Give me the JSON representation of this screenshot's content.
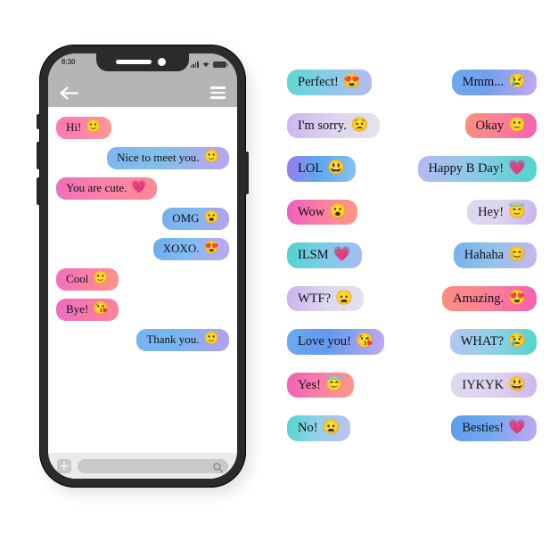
{
  "phone": {
    "status_bar": {
      "time": "8:30",
      "signal_icon": "signal-bars-icon",
      "wifi_icon": "wifi-icon",
      "battery_icon": "battery-full-icon"
    },
    "header": {
      "back_icon": "back-arrow-icon",
      "menu_icon": "hamburger-menu-icon",
      "bar_color": "#b5b5b5"
    },
    "conversation": [
      {
        "side": "left",
        "text": "Hi!",
        "emoji": "🙂",
        "emoji_name": "slightly-smiling-face",
        "gradient": "linear-gradient(100deg,#ff78b0 0%,#ff7fae 35%,#ff9a8f 100%)"
      },
      {
        "side": "right",
        "text": "Nice to meet you.",
        "emoji": "🙂",
        "emoji_name": "slightly-smiling-face",
        "gradient": "linear-gradient(100deg,#7fb5f0 0%,#83c0e8 45%,#bda3ef 100%)"
      },
      {
        "side": "left",
        "text": "You are cute.",
        "emoji": "💗",
        "emoji_name": "pink-heart",
        "gradient": "linear-gradient(100deg,#f06fb8 0%,#fb83a8 50%,#fb8b93 100%)"
      },
      {
        "side": "right",
        "text": "OMG",
        "emoji": "😮",
        "emoji_name": "face-with-open-mouth",
        "gradient": "linear-gradient(100deg,#79aeee 0%,#7fb9ec 45%,#b9a2f0 100%)"
      },
      {
        "side": "right",
        "text": "XOXO.",
        "emoji": "😍",
        "emoji_name": "heart-eyes-face",
        "gradient": "linear-gradient(100deg,#6fa9ef 0%,#80bdf0 45%,#c1a6f2 100%)"
      },
      {
        "side": "left",
        "text": "Cool",
        "emoji": "🙂",
        "emoji_name": "slightly-smiling-face",
        "gradient": "linear-gradient(100deg,#ef6fbe 0%,#fb7fa4 50%,#fb9487 100%)"
      },
      {
        "side": "left",
        "text": "Bye!",
        "emoji": "😘",
        "emoji_name": "face-blowing-a-kiss",
        "gradient": "linear-gradient(100deg,#e96fc9 0%,#fb76a8 55%,#fb8796 100%)"
      },
      {
        "side": "right",
        "text": "Thank you.",
        "emoji": "🙂",
        "emoji_name": "slightly-smiling-face",
        "gradient": "linear-gradient(100deg,#77b3f0 0%,#76b6ee 45%,#b79ff0 100%)"
      }
    ],
    "input_bar": {
      "attach_icon": "plus-icon",
      "search_icon": "search-icon",
      "input_value": "",
      "input_placeholder": ""
    }
  },
  "stickers": {
    "left_column": [
      {
        "text": "Perfect!",
        "emoji": "😍",
        "emoji_name": "heart-eyes-face",
        "tail": "left",
        "gradient": "linear-gradient(100deg,#5fd6d0 0%,#7fcfe4 40%,#b7b9f2 100%)"
      },
      {
        "text": "I'm sorry.",
        "emoji": "😟",
        "emoji_name": "worried-face",
        "tail": "left",
        "gradient": "linear-gradient(100deg,#cdb4ef 0%,#ddd4ef 50%,#e6e3ec 100%)"
      },
      {
        "text": "LOL",
        "emoji": "😃",
        "emoji_name": "grinning-face-big-eyes",
        "tail": "left",
        "gradient": "linear-gradient(100deg,#9a7cef 0%,#5fa7ef 45%,#85c3f0 100%)"
      },
      {
        "text": "Wow",
        "emoji": "😮",
        "emoji_name": "face-with-open-mouth",
        "tail": "left",
        "gradient": "linear-gradient(100deg,#ef5fbe 0%,#fb7fa4 50%,#fb9a80 100%)"
      },
      {
        "text": "ILSM",
        "emoji": "💗",
        "emoji_name": "pink-heart",
        "tail": "left",
        "gradient": "linear-gradient(100deg,#4fd4cf 0%,#79cde6 45%,#a8bdf2 100%)"
      },
      {
        "text": "WTF?",
        "emoji": "😦",
        "emoji_name": "frowning-face",
        "tail": "left",
        "gradient": "linear-gradient(100deg,#c9b2ee 0%,#ddd6ef 50%,#e4e2ec 100%)"
      },
      {
        "text": "Love you!",
        "emoji": "😘",
        "emoji_name": "face-blowing-a-kiss",
        "tail": "left",
        "gradient": "linear-gradient(100deg,#6fa9ef 0%,#5f9aef 40%,#c2a8f0 100%)"
      },
      {
        "text": "Yes!",
        "emoji": "😇",
        "emoji_name": "smiling-face-with-halo",
        "tail": "left",
        "gradient": "linear-gradient(100deg,#ef5fb8 0%,#fb7fa8 50%,#fb9a86 100%)"
      },
      {
        "text": "No!",
        "emoji": "😦",
        "emoji_name": "frowning-face",
        "tail": "none",
        "gradient": "linear-gradient(100deg,#4fd4cf 0%,#8fd2e6 45%,#c2c0f0 100%)"
      }
    ],
    "right_column": [
      {
        "text": "Mmm...",
        "emoji": "😢",
        "emoji_name": "crying-face",
        "tail": "right",
        "gradient": "linear-gradient(100deg,#6fa9ef 0%,#6fa0ef 40%,#c4a8f2 100%)"
      },
      {
        "text": "Okay",
        "emoji": "🙂",
        "emoji_name": "slightly-smiling-face",
        "tail": "right",
        "gradient": "linear-gradient(100deg,#fb8f7f 0%,#fb7f96 50%,#f45fb4 100%)"
      },
      {
        "text": "Happy B Day!",
        "emoji": "💗",
        "emoji_name": "pink-heart",
        "tail": "right",
        "gradient": "linear-gradient(100deg,#b7b9f2 0%,#8fc9e8 45%,#4fd4cf 100%)"
      },
      {
        "text": "Hey!",
        "emoji": "😇",
        "emoji_name": "smiling-face-with-halo",
        "tail": "right",
        "gradient": "linear-gradient(100deg,#ded9ef 0%,#ddd4ef 50%,#c9b2ee 100%)"
      },
      {
        "text": "Hahaha",
        "emoji": "😊",
        "emoji_name": "smiling-face-with-smiling-eyes",
        "tail": "right",
        "gradient": "linear-gradient(100deg,#79aeee 0%,#8fc3e8 45%,#c9b6ef 100%)"
      },
      {
        "text": "Amazing.",
        "emoji": "😍",
        "emoji_name": "heart-eyes-face",
        "tail": "right",
        "gradient": "linear-gradient(100deg,#fb8f7f 0%,#fb7f96 50%,#f45fb4 100%)"
      },
      {
        "text": "WHAT?",
        "emoji": "😢",
        "emoji_name": "crying-face",
        "tail": "right",
        "gradient": "linear-gradient(100deg,#b7c4f2 0%,#8fd0e6 50%,#4fd4cf 100%)"
      },
      {
        "text": "IYKYK",
        "emoji": "😃",
        "emoji_name": "grinning-face-big-eyes",
        "tail": "right",
        "gradient": "linear-gradient(100deg,#ded9ef 0%,#ddd4ef 50%,#ccb6ee 100%)"
      },
      {
        "text": "Besties!",
        "emoji": "💗",
        "emoji_name": "pink-heart",
        "tail": "right",
        "gradient": "linear-gradient(100deg,#5f9aef 0%,#6fa9ef 45%,#c2a8f2 100%)"
      }
    ]
  }
}
